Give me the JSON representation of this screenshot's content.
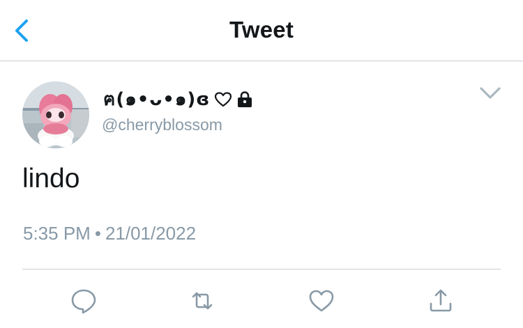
{
  "header": {
    "title": "Tweet",
    "back_icon": "chevron-left-icon"
  },
  "author": {
    "display_name": "ฅ(๑•ᴗ•๑)ɞ",
    "handle": "@cherryblossom",
    "badges": [
      "heart-outline-icon",
      "lock-icon"
    ],
    "avatar": "avatar"
  },
  "tweet": {
    "text": "lindo",
    "time": "5:35 PM",
    "separator": "•",
    "date": "21/01/2022"
  },
  "actions": [
    "reply-icon",
    "retweet-icon",
    "like-icon",
    "share-icon"
  ],
  "colors": {
    "accent": "#1da1f2",
    "secondary_text": "#8899a6",
    "divider": "#c8ccd0",
    "primary_text": "#14171a"
  }
}
